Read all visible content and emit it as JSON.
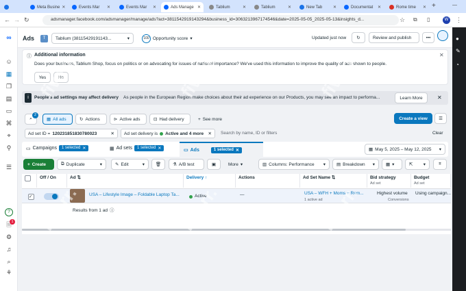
{
  "browser": {
    "tabs": [
      {
        "label": "",
        "color": "#1a73e8"
      },
      {
        "label": "Meta Busine",
        "color": "#0866ff"
      },
      {
        "label": "Events Mar",
        "color": "#0866ff"
      },
      {
        "label": "Events Mar",
        "color": "#0866ff"
      },
      {
        "label": "Ads Manage",
        "color": "#0866ff"
      },
      {
        "label": "Tablium",
        "color": "#888888"
      },
      {
        "label": "Tablium",
        "color": "#888888"
      },
      {
        "label": "New Tab",
        "color": "#1a73e8"
      },
      {
        "label": "Documentat",
        "color": "#0866ff"
      },
      {
        "label": "Rome time",
        "color": "#d93025"
      }
    ],
    "url": "adsmanager.facebook.com/adsmanager/manage/ads?act=3811542919143294&business_id=3063213967174546&date=2025-05-05_2025-05-13&insights_d..."
  },
  "header": {
    "title": "Ads",
    "account": "Tablium (38115429191143...",
    "score_value": "100",
    "score_label": "Opportunity score",
    "updated": "Updated just now",
    "review": "Review and publish"
  },
  "info": {
    "title": "Additional information",
    "text": "Does your business, Tablium Shop, focus on politics or on advocating for issues of national importance? We've used this information to improve the quality of ads shown to people.",
    "yes": "Yes",
    "no": "No"
  },
  "warning": {
    "title": "People's ad settings may affect delivery",
    "text": "As people in the European Region make choices about their ad experience on our Products, you may see an impact to performa...",
    "learn": "Learn More"
  },
  "toolbar": {
    "badge": "2",
    "all_ads": "All ads",
    "actions": "Actions",
    "active_ads": "Active ads",
    "had_delivery": "Had delivery",
    "see_more": "See more",
    "create_view": "Create a view"
  },
  "filters": {
    "f1_label": "Ad set ID =",
    "f1_value": "120231851830780023",
    "f2_label": "Ad set delivery is",
    "f2_value": "Active and 4 more",
    "search_placeholder": "Search by name, ID or filters",
    "clear": "Clear"
  },
  "levels": {
    "campaigns": "Campaigns",
    "ad_sets": "Ad sets",
    "ads": "Ads",
    "selected": "1 selected",
    "date_range": "May 5, 2025 – May 12, 2025"
  },
  "actionbar": {
    "create": "Create",
    "duplicate": "Duplicate",
    "edit": "Edit",
    "ab_test": "A/B test",
    "more": "More",
    "columns": "Columns: Performance",
    "breakdown": "Breakdown"
  },
  "table": {
    "headers": [
      "Off / On",
      "Ad",
      "Delivery",
      "Actions",
      "Ad Set Name",
      "Bid strategy",
      "Budget"
    ],
    "subheaders": {
      "bid": "Ad set",
      "budget": "Ad set"
    },
    "row": {
      "ad": "USA – Lifestyle Image – Foldable Laptop Ta...",
      "delivery": "Active",
      "actions": "—",
      "adset": "USA – WFH + Moms + Rem...",
      "adset_sub": "1 active ad",
      "bid": "Highest volume",
      "bid_sub": "Conversions",
      "budget": "Using campaign..."
    },
    "results": "Results from 1 ad"
  },
  "nav": {
    "notif_count": "1"
  },
  "watermark": "fiverr.",
  "colors": {
    "accent": "#0a78be",
    "green": "#1a7f37",
    "active_dot": "#31a24c"
  }
}
